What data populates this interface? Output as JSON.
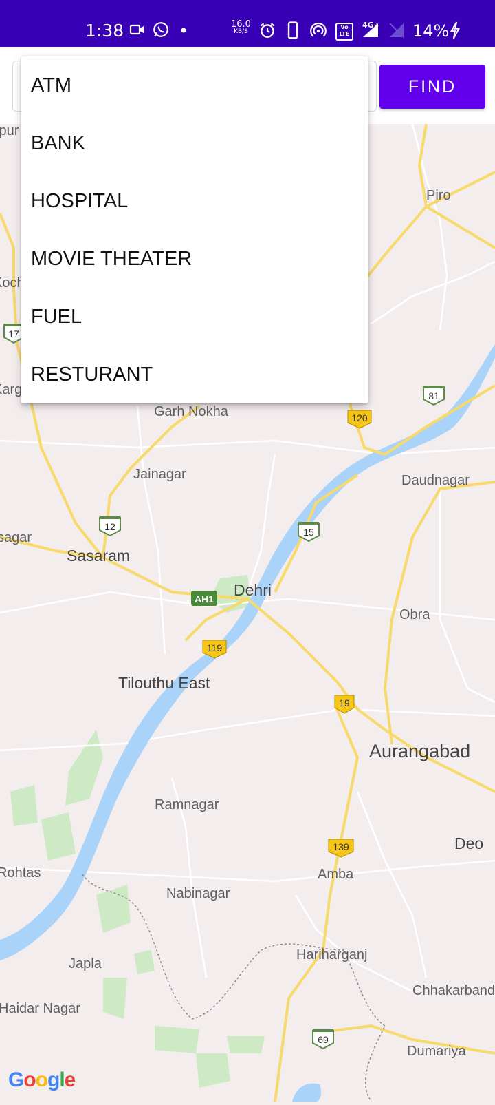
{
  "status_bar": {
    "time": "1:38",
    "net_speed_value": "16.0",
    "net_speed_unit": "KB/S",
    "volte_label": "Vo LTE",
    "network_type": "4G+",
    "battery": "14%",
    "icons": [
      "video-call-icon",
      "whatsapp-icon",
      "dot-icon",
      "alarm-icon",
      "phone-icon",
      "hotspot-icon",
      "volte-icon",
      "signal-icon",
      "no-sim-icon",
      "charging-icon"
    ]
  },
  "search": {
    "find_button": "FIND",
    "dropdown_options": [
      "ATM",
      "BANK",
      "HOSPITAL",
      "MOVIE THEATER",
      "FUEL",
      "RESTURANT"
    ]
  },
  "map": {
    "places": {
      "piro": "Piro",
      "koch": "Koch",
      "karg": "Karg",
      "garh_nokha": "Garh Nokha",
      "jainagar": "Jainagar",
      "daudnagar": "Daudnagar",
      "sagar": "sagar",
      "sasaram": "Sasaram",
      "dehri": "Dehri",
      "obra": "Obra",
      "tilouthu_east": "Tilouthu East",
      "aurangabad": "Aurangabad",
      "ramnagar": "Ramnagar",
      "deo": "Deo",
      "rohtas": "Rohtas",
      "amba": "Amba",
      "nabinagar": "Nabinagar",
      "harihar": "Hariharganj",
      "japla": "Japla",
      "chhakarband": "Chhakarband",
      "haidar_nagar": "Haidar Nagar",
      "dumariya": "Dumariya",
      "ipur": "ipur"
    },
    "shields": {
      "nh17": "17",
      "nh81": "81",
      "nh120": "120",
      "nh12": "12",
      "nh15": "15",
      "ah1": "AH1",
      "nh119": "119",
      "nh19": "19",
      "nh139": "139",
      "nh69": "69"
    },
    "attribution": "Google",
    "colors": {
      "land": "#f4edee",
      "water": "#aad3f9",
      "road_major": "#f8d96b",
      "road_minor": "#ffffff",
      "park": "#cdeac4"
    }
  }
}
